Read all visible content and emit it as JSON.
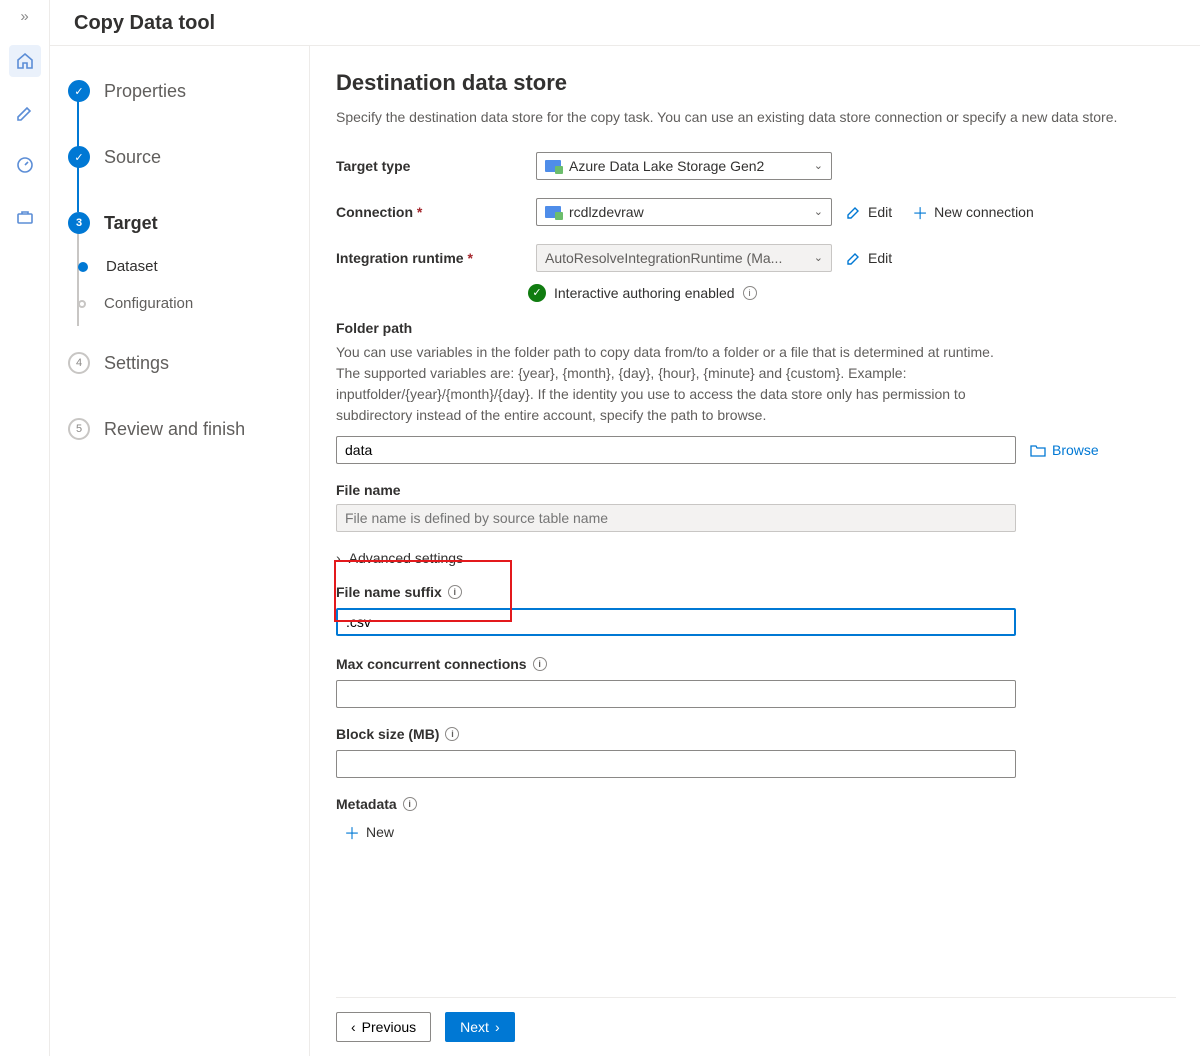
{
  "title": "Copy Data tool",
  "steps": {
    "properties": "Properties",
    "source": "Source",
    "target": "Target",
    "target_num": "3",
    "dataset": "Dataset",
    "configuration": "Configuration",
    "settings": "Settings",
    "settings_num": "4",
    "review": "Review and finish",
    "review_num": "5"
  },
  "page": {
    "heading": "Destination data store",
    "subtitle": "Specify the destination data store for the copy task. You can use an existing data store connection or specify a new data store.",
    "target_type_label": "Target type",
    "target_type_value": "Azure Data Lake Storage Gen2",
    "connection_label": "Connection",
    "connection_value": "rcdlzdevraw",
    "edit": "Edit",
    "new_connection": "New connection",
    "runtime_label": "Integration runtime",
    "runtime_value": "AutoResolveIntegrationRuntime (Ma...",
    "interactive_status": "Interactive authoring enabled",
    "folder_path_label": "Folder path",
    "folder_help": "You can use variables in the folder path to copy data from/to a folder or a file that is determined at runtime. The supported variables are: {year}, {month}, {day}, {hour}, {minute} and {custom}. Example: inputfolder/{year}/{month}/{day}. If the identity you use to access the data store only has permission to subdirectory instead of the entire account, specify the path to browse.",
    "folder_value": "data",
    "browse": "Browse",
    "file_name_label": "File name",
    "file_name_placeholder": "File name is defined by source table name",
    "advanced": "Advanced settings",
    "suffix_label": "File name suffix",
    "suffix_value": ".csv",
    "max_conn_label": "Max concurrent connections",
    "block_size_label": "Block size (MB)",
    "metadata_label": "Metadata",
    "new": "New",
    "previous": "Previous",
    "next": "Next"
  }
}
